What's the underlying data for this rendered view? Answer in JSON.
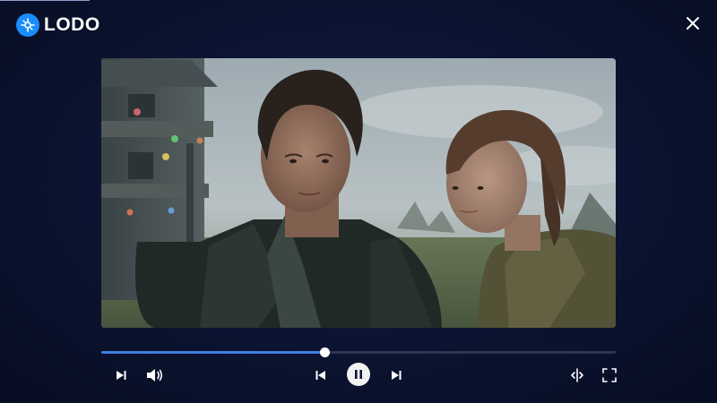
{
  "app": {
    "logo_text": "LODO"
  },
  "player": {
    "progress": 0.433,
    "state": "playing"
  },
  "icons": {
    "logo": "logo-icon",
    "close": "close-icon",
    "next_episode": "next-episode-icon",
    "volume": "volume-icon",
    "previous": "previous-icon",
    "pause": "pause-icon",
    "next": "next-icon",
    "audio_track": "audio-track-icon",
    "fullscreen": "fullscreen-icon"
  },
  "colors": {
    "accent": "#3f7fe0",
    "brand": "#1a8cff",
    "background": "#0a1128"
  }
}
